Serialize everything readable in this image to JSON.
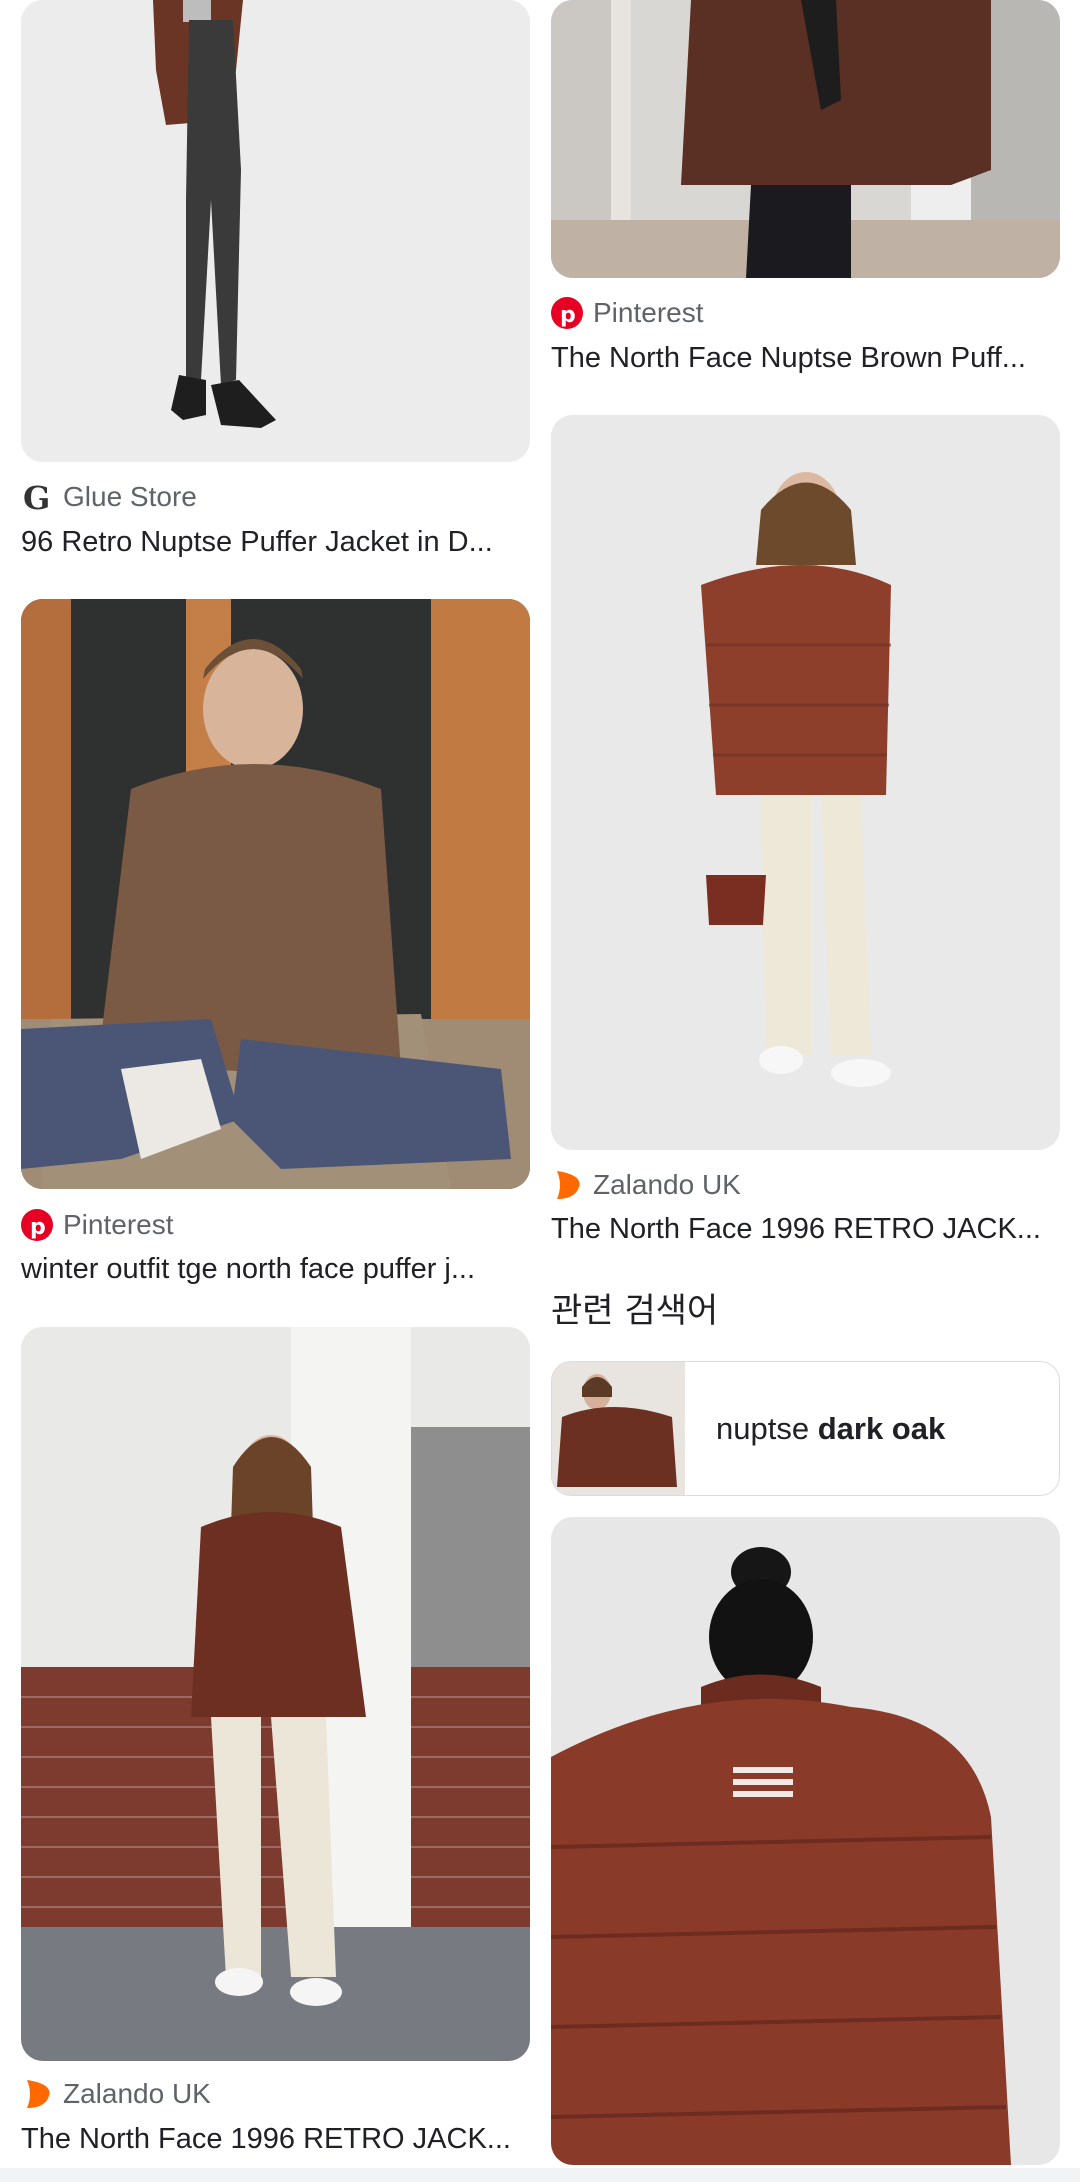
{
  "results": {
    "left": [
      {
        "source": "Glue Store",
        "title": "96 Retro Nuptse Puffer Jacket in D..."
      },
      {
        "source": "Pinterest",
        "title": "winter outfit tge north face puffer j..."
      },
      {
        "source": "Zalando UK",
        "title": "The North Face 1996 RETRO JACK..."
      }
    ],
    "right": [
      {
        "source": "Pinterest",
        "title": "The North Face Nuptse Brown Puff..."
      },
      {
        "source": "Zalando UK",
        "title": "The North Face 1996 RETRO JACK..."
      }
    ]
  },
  "related": {
    "heading": "관련 검색어",
    "item": {
      "prefix": "nuptse ",
      "bold": "dark oak"
    }
  },
  "colors": {
    "pinterest": "#e60023",
    "zalando": "#ff6900",
    "jacket_brown": "#6b3526"
  }
}
